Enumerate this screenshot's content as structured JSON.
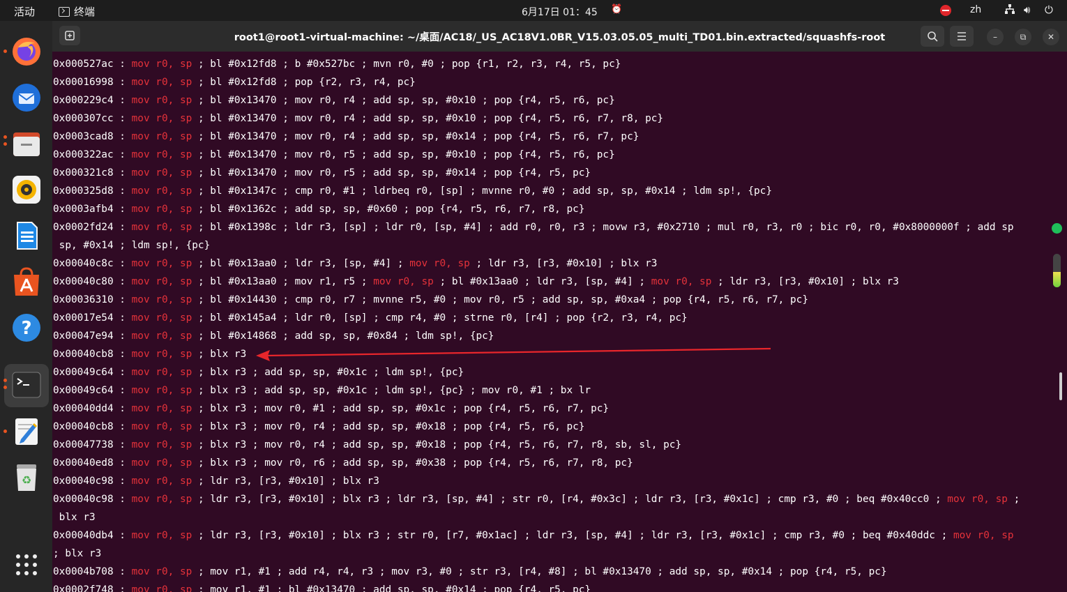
{
  "topbar": {
    "activities": "活动",
    "app_name": "终端",
    "clock": "6月17日 01：45",
    "lang": "zh"
  },
  "dock": {
    "items": [
      "firefox-icon",
      "thunderbird-icon",
      "files-icon",
      "rhythmbox-icon",
      "libreoffice-writer-icon",
      "app-center-icon",
      "help-icon",
      "terminal-icon",
      "text-editor-icon",
      "trash-icon",
      "show-apps-icon"
    ]
  },
  "window": {
    "title": "root1@root1-virtual-machine: ~/桌面/AC18/_US_AC18V1.0BR_V15.03.05.05_multi_TD01.bin.extracted/squashfs-root"
  },
  "colors": {
    "terminal_bg": "#300a24",
    "highlight": "#e5323a",
    "arrow": "#e8262b"
  },
  "terminal": {
    "lines": [
      [
        "0x000527ac : ",
        "@mov r0, sp",
        " ; bl #0x12fd8 ; b #0x527bc ; mvn r0, #0 ; pop {r1, r2, r3, r4, r5, pc}"
      ],
      [
        "0x00016998 : ",
        "@mov r0, sp",
        " ; bl #0x12fd8 ; pop {r2, r3, r4, pc}"
      ],
      [
        "0x000229c4 : ",
        "@mov r0, sp",
        " ; bl #0x13470 ; mov r0, r4 ; add sp, sp, #0x10 ; pop {r4, r5, r6, pc}"
      ],
      [
        "0x000307cc : ",
        "@mov r0, sp",
        " ; bl #0x13470 ; mov r0, r4 ; add sp, sp, #0x10 ; pop {r4, r5, r6, r7, r8, pc}"
      ],
      [
        "0x0003cad8 : ",
        "@mov r0, sp",
        " ; bl #0x13470 ; mov r0, r4 ; add sp, sp, #0x14 ; pop {r4, r5, r6, r7, pc}"
      ],
      [
        "0x000322ac : ",
        "@mov r0, sp",
        " ; bl #0x13470 ; mov r0, r5 ; add sp, sp, #0x10 ; pop {r4, r5, r6, pc}"
      ],
      [
        "0x000321c8 : ",
        "@mov r0, sp",
        " ; bl #0x13470 ; mov r0, r5 ; add sp, sp, #0x14 ; pop {r4, r5, pc}"
      ],
      [
        "0x000325d8 : ",
        "@mov r0, sp",
        " ; bl #0x1347c ; cmp r0, #1 ; ldrbeq r0, [sp] ; mvnne r0, #0 ; add sp, sp, #0x14 ; ldm sp!, {pc}"
      ],
      [
        "0x0003afb4 : ",
        "@mov r0, sp",
        " ; bl #0x1362c ; add sp, sp, #0x60 ; pop {r4, r5, r6, r7, r8, pc}"
      ],
      [
        "0x0002fd24 : ",
        "@mov r0, sp",
        " ; bl #0x1398c ; ldr r3, [sp] ; ldr r0, [sp, #4] ; add r0, r0, r3 ; movw r3, #0x2710 ; mul r0, r3, r0 ; bic r0, r0, #0x8000000f ; add sp"
      ],
      [
        " sp, #0x14 ; ldm sp!, {pc}"
      ],
      [
        "0x00040c8c : ",
        "@mov r0, sp",
        " ; bl #0x13aa0 ; ldr r3, [sp, #4] ; ",
        "@mov r0, sp",
        " ; ldr r3, [r3, #0x10] ; blx r3"
      ],
      [
        "0x00040c80 : ",
        "@mov r0, sp",
        " ; bl #0x13aa0 ; mov r1, r5 ; ",
        "@mov r0, sp",
        " ; bl #0x13aa0 ; ldr r3, [sp, #4] ; ",
        "@mov r0, sp",
        " ; ldr r3, [r3, #0x10] ; blx r3"
      ],
      [
        "0x00036310 : ",
        "@mov r0, sp",
        " ; bl #0x14430 ; cmp r0, r7 ; mvnne r5, #0 ; mov r0, r5 ; add sp, sp, #0xa4 ; pop {r4, r5, r6, r7, pc}"
      ],
      [
        "0x00017e54 : ",
        "@mov r0, sp",
        " ; bl #0x145a4 ; ldr r0, [sp] ; cmp r4, #0 ; strne r0, [r4] ; pop {r2, r3, r4, pc}"
      ],
      [
        "0x00047e94 : ",
        "@mov r0, sp",
        " ; bl #0x14868 ; add sp, sp, #0x84 ; ldm sp!, {pc}"
      ],
      [
        "0x00040cb8 : ",
        "@mov r0, sp",
        " ; blx r3"
      ],
      [
        "0x00049c64 : ",
        "@mov r0, sp",
        " ; blx r3 ; add sp, sp, #0x1c ; ldm sp!, {pc}"
      ],
      [
        "0x00049c64 : ",
        "@mov r0, sp",
        " ; blx r3 ; add sp, sp, #0x1c ; ldm sp!, {pc} ; mov r0, #1 ; bx lr"
      ],
      [
        "0x00040dd4 : ",
        "@mov r0, sp",
        " ; blx r3 ; mov r0, #1 ; add sp, sp, #0x1c ; pop {r4, r5, r6, r7, pc}"
      ],
      [
        "0x00040cb8 : ",
        "@mov r0, sp",
        " ; blx r3 ; mov r0, r4 ; add sp, sp, #0x18 ; pop {r4, r5, r6, pc}"
      ],
      [
        "0x00047738 : ",
        "@mov r0, sp",
        " ; blx r3 ; mov r0, r4 ; add sp, sp, #0x18 ; pop {r4, r5, r6, r7, r8, sb, sl, pc}"
      ],
      [
        "0x00040ed8 : ",
        "@mov r0, sp",
        " ; blx r3 ; mov r0, r6 ; add sp, sp, #0x38 ; pop {r4, r5, r6, r7, r8, pc}"
      ],
      [
        "0x00040c98 : ",
        "@mov r0, sp",
        " ; ldr r3, [r3, #0x10] ; blx r3"
      ],
      [
        "0x00040c98 : ",
        "@mov r0, sp",
        " ; ldr r3, [r3, #0x10] ; blx r3 ; ldr r3, [sp, #4] ; str r0, [r4, #0x3c] ; ldr r3, [r3, #0x1c] ; cmp r3, #0 ; beq #0x40cc0 ; ",
        "@mov r0, sp",
        " ;"
      ],
      [
        " blx r3"
      ],
      [
        "0x00040db4 : ",
        "@mov r0, sp",
        " ; ldr r3, [r3, #0x10] ; blx r3 ; str r0, [r7, #0x1ac] ; ldr r3, [sp, #4] ; ldr r3, [r3, #0x1c] ; cmp r3, #0 ; beq #0x40ddc ; ",
        "@mov r0, sp"
      ],
      [
        "; blx r3"
      ],
      [
        "0x0004b708 : ",
        "@mov r0, sp",
        " ; mov r1, #1 ; add r4, r4, r3 ; mov r3, #0 ; str r3, [r4, #8] ; bl #0x13470 ; add sp, sp, #0x14 ; pop {r4, r5, pc}"
      ],
      [
        "0x0002f748 : ",
        "@mov r0, sp",
        " ; mov r1, #1 ; bl #0x13470 ; add sp, sp, #0x14 ; pop {r4, r5, pc}"
      ]
    ]
  }
}
